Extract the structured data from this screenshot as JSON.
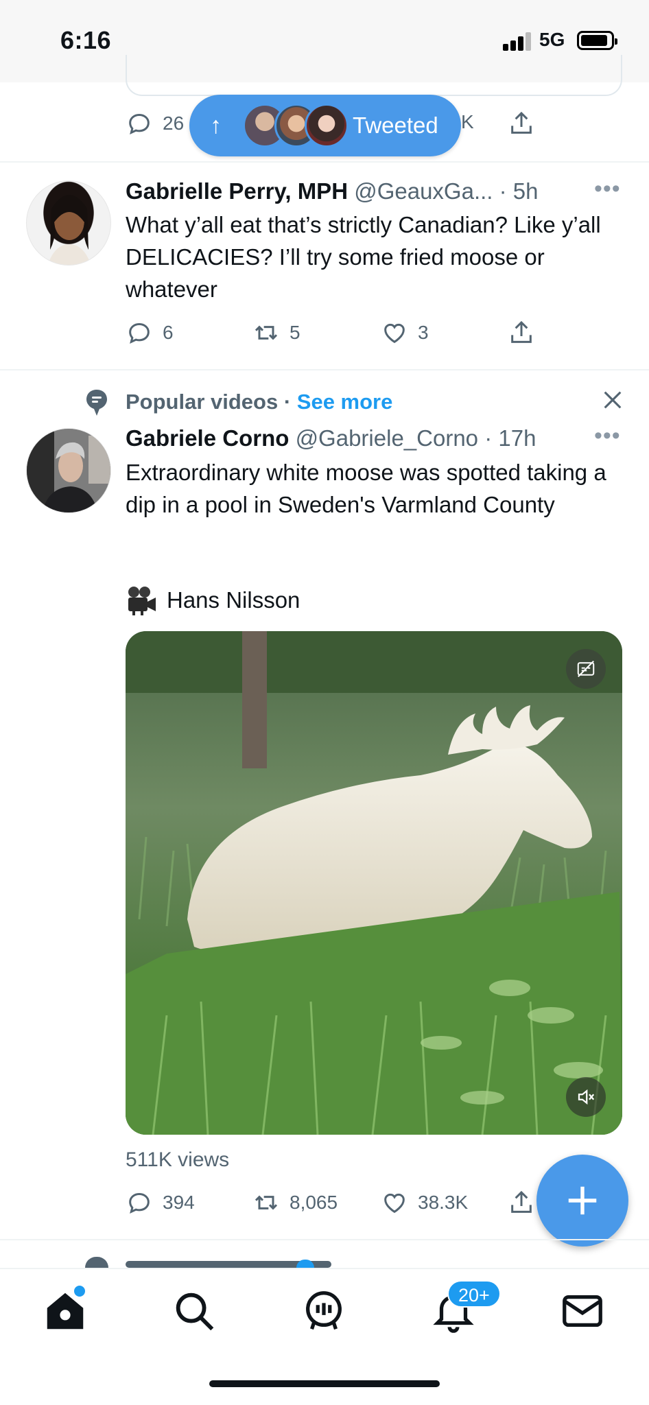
{
  "status_bar": {
    "time": "6:16",
    "network": "5G"
  },
  "prev_tweet": {
    "reply_count": "26",
    "like_count_partial": "K"
  },
  "tweeted_pill": {
    "label": "Tweeted",
    "arrow": "↑"
  },
  "tweet1": {
    "name": "Gabrielle Perry, MPH",
    "handle": "@GeauxGa...",
    "time": "· 5h",
    "text": "What y’all eat that’s strictly Canadian? Like y’all DELICACIES? I’ll try some fried moose or whatever",
    "replies": "6",
    "retweets": "5",
    "likes": "3"
  },
  "popular": {
    "label": "Popular videos · ",
    "see_more": "See more"
  },
  "tweet2": {
    "name": "Gabriele Corno",
    "handle": "@Gabriele_Corno",
    "time": "· 17h",
    "text": "Extraordinary white moose was spotted taking a dip in a pool in Sweden's Varmland County",
    "video_credit": "Hans Nilsson",
    "views": "511K views",
    "replies": "394",
    "retweets": "8,065",
    "likes": "38.3K"
  },
  "tabbar": {
    "notifications_badge": "20+"
  },
  "icons": {
    "reply": "reply-icon",
    "retweet": "retweet-icon",
    "like": "like-icon",
    "share": "share-icon",
    "more": "more-icon",
    "close": "close-icon",
    "camera": "video-camera-icon",
    "cc": "closed-captions-icon",
    "mute": "mute-icon",
    "compose": "compose-plus-icon",
    "home": "home-icon",
    "search": "search-icon",
    "spaces": "spaces-icon",
    "notifications": "bell-icon",
    "messages": "mail-icon"
  },
  "colors": {
    "accent": "#1d9bf0",
    "pill": "#4a99e9",
    "secondary_text": "#536471"
  }
}
